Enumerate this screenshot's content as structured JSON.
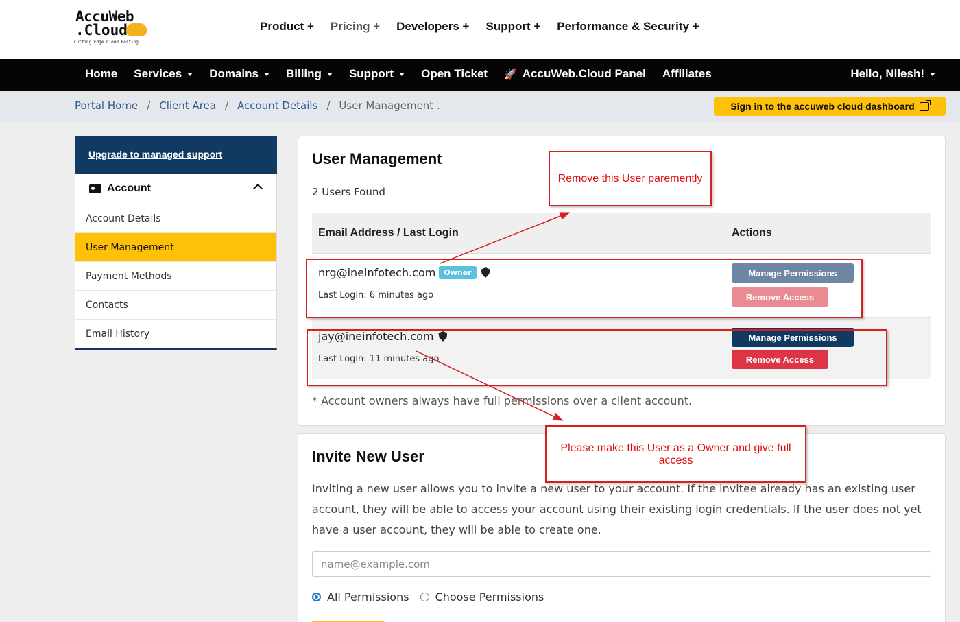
{
  "brand": {
    "line1": "AccuWeb",
    "line2": ".Cloud",
    "tagline": "Cutting Edge Cloud Hosting"
  },
  "top_nav": [
    "Product +",
    "Pricing +",
    "Developers +",
    "Support +",
    "Performance & Security +"
  ],
  "main_nav": {
    "items": [
      "Home",
      "Services",
      "Domains",
      "Billing",
      "Support",
      "Open Ticket",
      "AccuWeb.Cloud Panel",
      "Affiliates"
    ],
    "greeting": "Hello, Nilesh!"
  },
  "breadcrumb": [
    "Portal Home",
    "Client Area",
    "Account Details",
    "User Management ."
  ],
  "signin_button": "Sign in to the accuweb cloud dashboard",
  "sidebar": {
    "upgrade_link": "Upgrade to managed support",
    "section_title": "Account",
    "items": [
      "Account Details",
      "User Management",
      "Payment Methods",
      "Contacts",
      "Email History"
    ]
  },
  "user_management": {
    "title": "User Management",
    "users_found": "2 Users Found",
    "headers": [
      "Email Address / Last Login",
      "Actions"
    ],
    "users": [
      {
        "email": "nrg@ineinfotech.com",
        "badge": "Owner",
        "last_login": "Last Login: 6 minutes ago",
        "manage_label": "Manage Permissions",
        "remove_label": "Remove Access"
      },
      {
        "email": "jay@ineinfotech.com",
        "badge": "",
        "last_login": "Last Login: 11 minutes ago",
        "manage_label": "Manage Permissions",
        "remove_label": "Remove Access"
      }
    ],
    "footnote": "* Account owners always have full permissions over a client account."
  },
  "invite": {
    "title": "Invite New User",
    "description": "Inviting a new user allows you to invite a new user to your account. If the invitee already has an existing user account, they will be able to access your account using their existing login credentials. If the user does not yet have a user account, they will be able to create one.",
    "email_placeholder": "name@example.com",
    "radio_all": "All Permissions",
    "radio_choose": "Choose Permissions"
  },
  "annotations": {
    "remove_note": "Remove this User paremently",
    "owner_note": "Please make this User as a Owner and give full access"
  },
  "colors": {
    "accent_yellow": "#ffc107",
    "navy": "#113a63",
    "danger": "#dc3545",
    "annotation_red": "#d42020"
  }
}
